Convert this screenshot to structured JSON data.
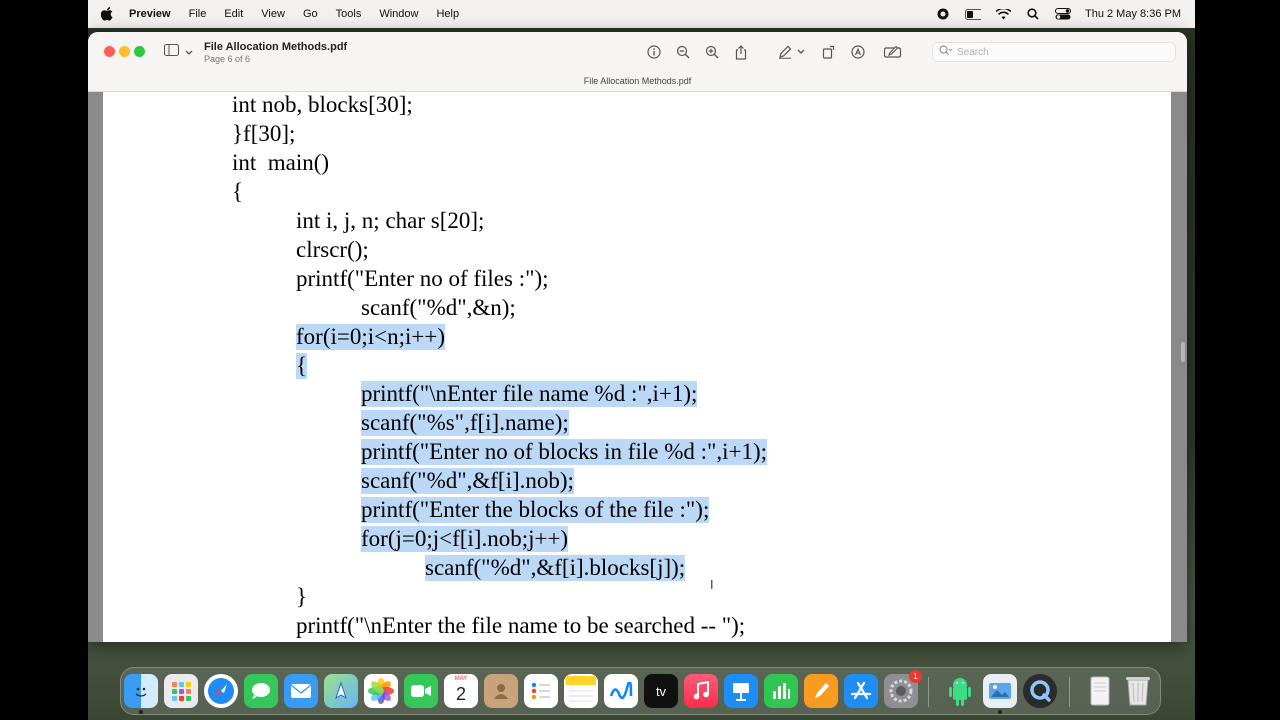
{
  "menubar": {
    "app_name": "Preview",
    "items": [
      "File",
      "Edit",
      "View",
      "Go",
      "Tools",
      "Window",
      "Help"
    ],
    "clock": "Thu 2 May  8:36 PM"
  },
  "window": {
    "doc_title": "File Allocation Methods.pdf",
    "page_info": "Page 6 of 6",
    "center_title": "File Allocation Methods.pdf",
    "search_placeholder": "Search"
  },
  "code_lines": [
    {
      "text": "int nob, blocks[30];",
      "selected": false
    },
    {
      "text": "}f[30];",
      "selected": false
    },
    {
      "text": "int  main()",
      "selected": false
    },
    {
      "text": "{",
      "selected": false
    },
    {
      "text": "int i, j, n; char s[20];",
      "selected": false
    },
    {
      "text": "clrscr();",
      "selected": false
    },
    {
      "text": "printf(\"Enter no of files :\");",
      "selected": false
    },
    {
      "text": "scanf(\"%d\",&n);",
      "selected": false
    },
    {
      "text": "for(i=0;i<n;i++)",
      "selected": true
    },
    {
      "text": "{",
      "selected": true
    },
    {
      "text": "printf(\"\\nEnter file name %d :\",i+1);",
      "selected": true
    },
    {
      "text": "scanf(\"%s\",f[i].name);",
      "selected": true
    },
    {
      "text": "printf(\"Enter no of blocks in file %d :\",i+1);",
      "selected": true
    },
    {
      "text": "scanf(\"%d\",&f[i].nob);",
      "selected": true
    },
    {
      "text": "printf(\"Enter the blocks of the file :\");",
      "selected": true
    },
    {
      "text": "for(j=0;j<f[i].nob;j++)",
      "selected": true
    },
    {
      "text": "scanf(\"%d\",&f[i].blocks[j]);",
      "selected": true
    },
    {
      "text": "}",
      "selected": false
    },
    {
      "text": "printf(\"\\nEnter the file name to be searched -- \");",
      "selected": false
    }
  ],
  "dock": {
    "calendar_month": "MAY",
    "calendar_day": "2",
    "settings_badge": "1",
    "tv_label": "tv",
    "apps": [
      "finder-icon",
      "launchpad-icon",
      "safari-icon",
      "messages-icon",
      "mail-icon",
      "maps-icon",
      "photos-icon",
      "facetime-icon",
      "calendar-icon",
      "contacts-icon",
      "reminders-icon",
      "notes-icon",
      "freeform-icon",
      "tv-icon",
      "music-icon",
      "keynote-icon",
      "numbers-icon",
      "pages-icon",
      "app-store-icon",
      "system-settings-icon",
      "android-studio-icon",
      "preview-icon",
      "quicktime-icon",
      "downloads-icon",
      "trash-icon"
    ]
  }
}
